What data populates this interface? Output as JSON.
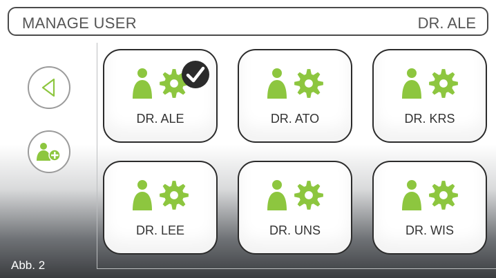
{
  "header": {
    "title": "MANAGE USER",
    "current_user": "DR. ALE"
  },
  "sidebar": {
    "back_icon": "back-triangle-icon",
    "add_user_icon": "add-user-icon"
  },
  "tiles": [
    {
      "label": "DR. ALE",
      "selected": true
    },
    {
      "label": "DR. ATO",
      "selected": false
    },
    {
      "label": "DR. KRS",
      "selected": false
    },
    {
      "label": "DR. LEE",
      "selected": false
    },
    {
      "label": "DR. UNS",
      "selected": false
    },
    {
      "label": "DR. WIS",
      "selected": false
    }
  ],
  "colors": {
    "accent_green": "#8dc63f",
    "frame": "#2b2b2b",
    "check_bg": "#2b2b2b"
  },
  "caption": "Abb. 2"
}
